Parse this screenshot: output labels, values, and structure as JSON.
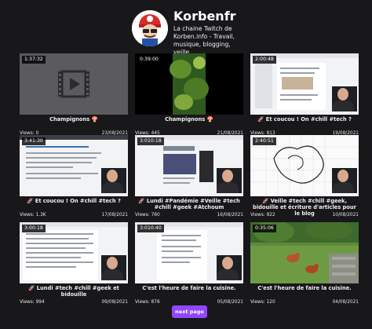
{
  "channel": {
    "name": "Korbenfr",
    "description": "La chaine Twitch de Korben.info - Travail, musique, blogging, veille..."
  },
  "videos": [
    {
      "duration": "1:37:32",
      "title": "Champignons 🍄",
      "views": "Views: 0",
      "date": "23/08/2021",
      "thumb": "placeholder-video-icon"
    },
    {
      "duration": "0:39:00",
      "title": "Champignons 🍄",
      "views": "Views: 445",
      "date": "21/08/2021",
      "thumb": "mushroom-forest"
    },
    {
      "duration": "2:00:48",
      "title": "🚀 Et coucou ! On #chill #tech ?",
      "views": "Views: 813",
      "date": "19/08/2021",
      "thumb": "stream-screen"
    },
    {
      "duration": "3:41:30",
      "title": "🚀 Et coucou ! On #chill #tech ?",
      "views": "Views: 1.3K",
      "date": "17/08/2021",
      "thumb": "stream-screen"
    },
    {
      "duration": "3:010:18",
      "title": "🚀 Lundi #Pandémie #Veille #tech #chill #geek #Atchoum",
      "views": "Views: 760",
      "date": "16/08/2021",
      "thumb": "stream-screen"
    },
    {
      "duration": "2:40:51",
      "title": "🚀 Veille #tech #chill #geek, bidouille et écriture d'articles pour le blog",
      "views": "Views: 822",
      "date": "10/08/2021",
      "thumb": "drawing-screen"
    },
    {
      "duration": "3:00:18",
      "title": "🚀 Lundi #tech #chill #geek et bidouille",
      "views": "Views: 994",
      "date": "09/08/2021",
      "thumb": "stream-screen"
    },
    {
      "duration": "3:010:40",
      "title": "C'est l'heure de faire la cuisine.",
      "views": "Views: 876",
      "date": "05/08/2021",
      "thumb": "stream-screen"
    },
    {
      "duration": "0:35:06",
      "title": "C'est l'heure de faire la cuisine.",
      "views": "Views: 120",
      "date": "04/08/2021",
      "thumb": "garden-chickens"
    }
  ],
  "pagination": {
    "next_label": "next page"
  }
}
